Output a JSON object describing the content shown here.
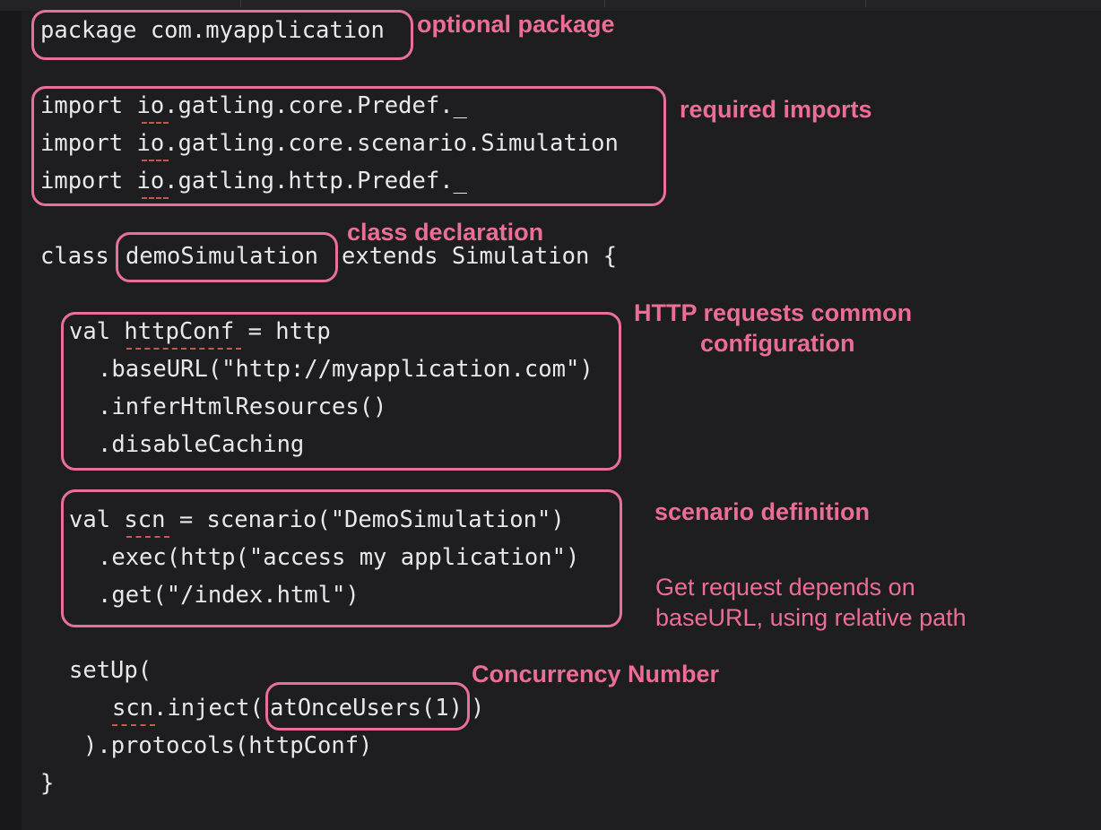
{
  "code": {
    "line_package": "package com.myapplication",
    "line_import_1": "import io.gatling.core.Predef._",
    "line_import_2": "import io.gatling.core.scenario.Simulation",
    "line_import_3": "import io.gatling.http.Predef._",
    "line_class_keyword": "class",
    "line_class_name": "demoSimulation",
    "line_class_rest": "extends Simulation {",
    "line_httpconf_1": "val httpConf = http",
    "line_httpconf_2": ".baseURL(\"http://myapplication.com\")",
    "line_httpconf_3": ".inferHtmlResources()",
    "line_httpconf_4": ".disableCaching",
    "line_scn_1": "val scn = scenario(\"DemoSimulation\")",
    "line_scn_2": ".exec(http(\"access my application\")",
    "line_scn_3": ".get(\"/index.html\")",
    "line_setup_1": "setUp(",
    "line_setup_2_prefix": "scn.inject(",
    "line_setup_2_arg": "atOnceUsers(1)",
    "line_setup_2_suffix": ")",
    "line_setup_3": ").protocols(httpConf)",
    "line_close": "}"
  },
  "annotations": {
    "optional_package": "optional package",
    "required_imports": "required imports",
    "class_declaration": "class declaration",
    "http_common_config_line1": "HTTP requests common",
    "http_common_config_line2": "configuration",
    "scenario_definition": "scenario definition",
    "get_request_note_line1": "Get request depends on",
    "get_request_note_line2": "baseURL, using relative path",
    "concurrency_number": "Concurrency Number"
  },
  "colors": {
    "background": "#1e1e20",
    "code_text": "#e8e8e8",
    "annotation": "#ec6d95",
    "squiggle": "#c45a4e"
  }
}
